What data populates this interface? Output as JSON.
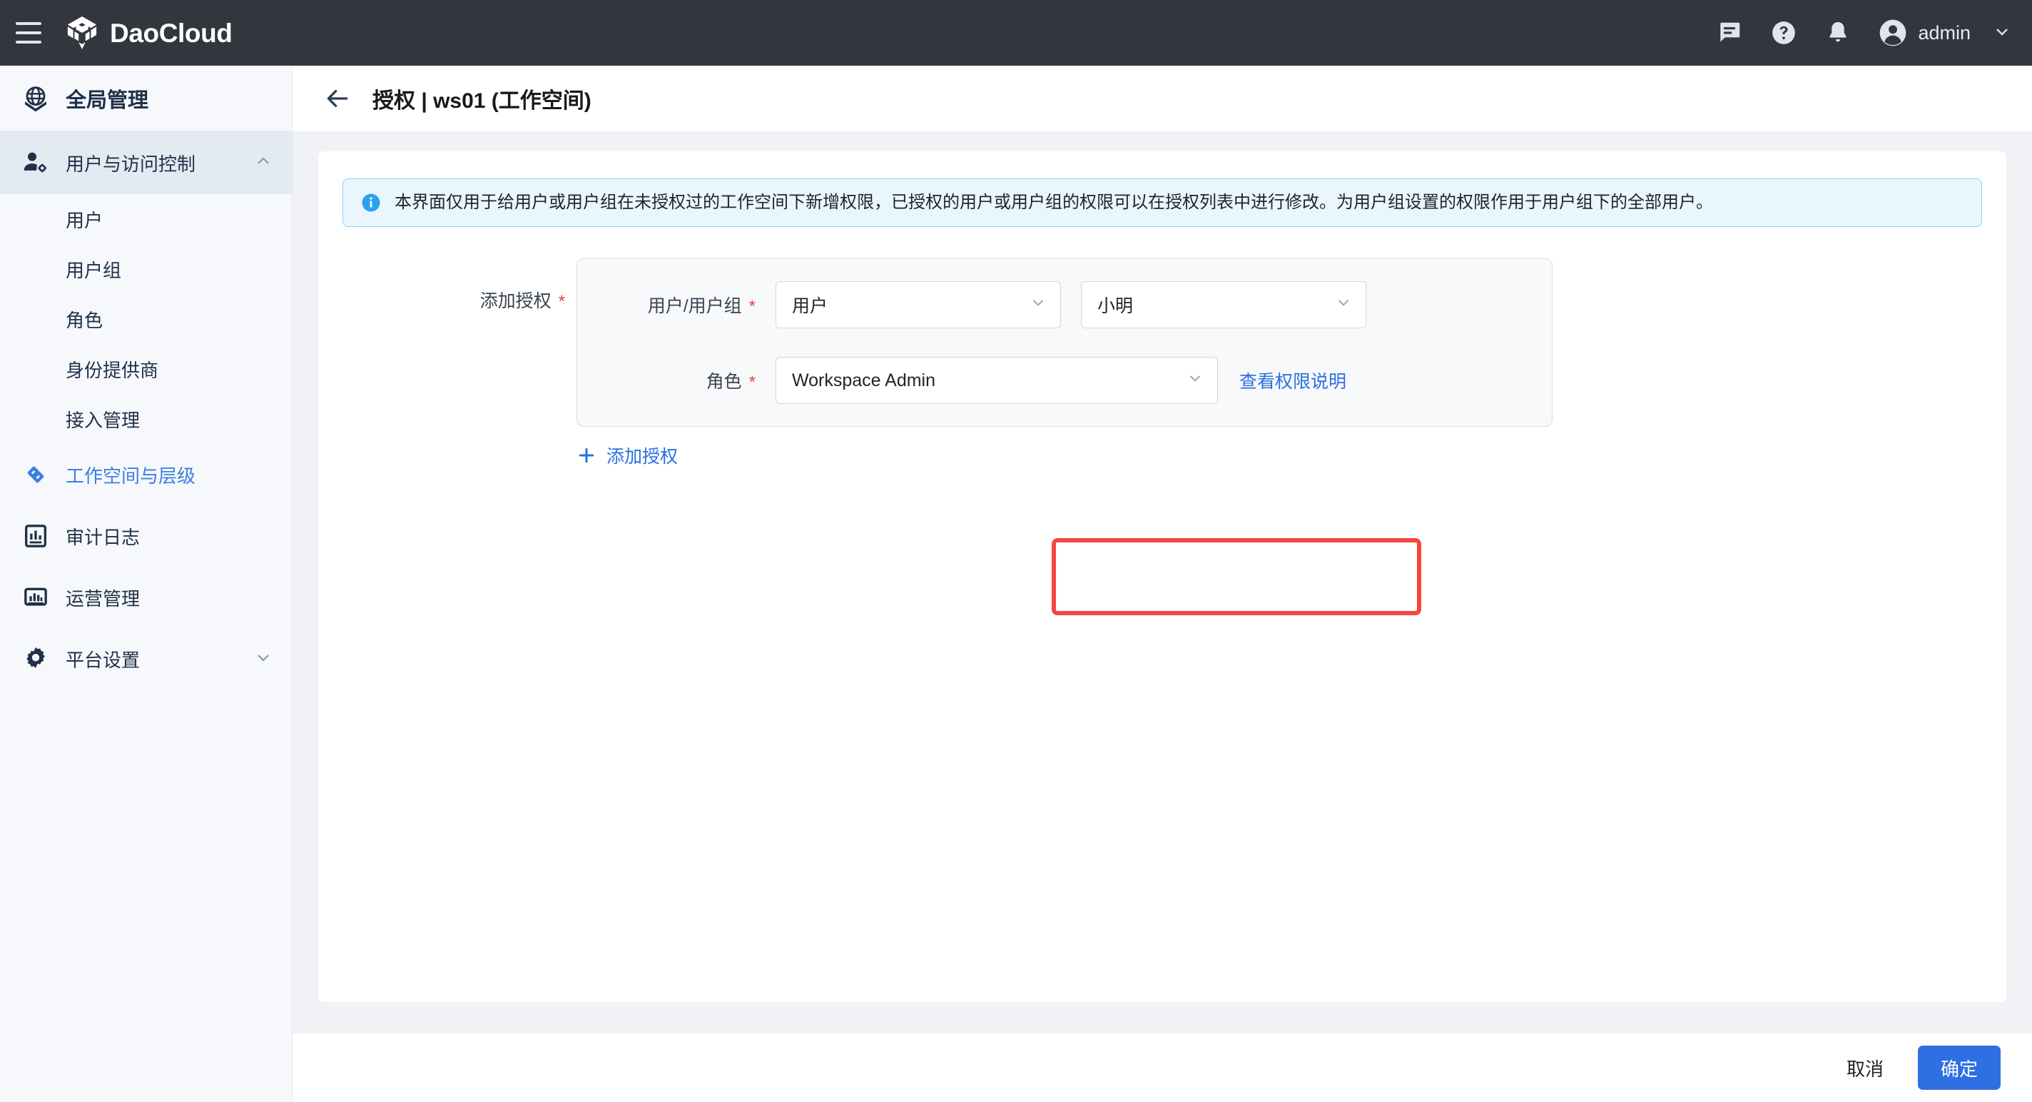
{
  "topbar": {
    "brand": "DaoCloud",
    "menu_icon": "hamburger-icon",
    "icons": [
      "message-icon",
      "help-icon",
      "bell-icon"
    ],
    "user": "admin"
  },
  "sidebar": {
    "top_item": {
      "label": "全局管理",
      "icon": "globe-icon"
    },
    "groups": [
      {
        "label": "用户与访问控制",
        "icon": "user-settings-icon",
        "expanded": true,
        "caret": "chevron-up-icon"
      }
    ],
    "sub_items": [
      {
        "label": "用户"
      },
      {
        "label": "用户组"
      },
      {
        "label": "角色"
      },
      {
        "label": "身份提供商"
      },
      {
        "label": "接入管理"
      }
    ],
    "items": [
      {
        "label": "工作空间与层级",
        "icon": "workspace-icon",
        "active": true
      },
      {
        "label": "审计日志",
        "icon": "audit-icon",
        "active": false
      },
      {
        "label": "运营管理",
        "icon": "operations-icon",
        "active": false
      },
      {
        "label": "平台设置",
        "icon": "gear-icon",
        "active": false,
        "caret": "chevron-down-icon"
      }
    ]
  },
  "page": {
    "back_icon": "arrow-left-icon",
    "title": "授权 | ws01 (工作空间)"
  },
  "banner": {
    "icon": "info-icon",
    "text": "本界面仅用于给用户或用户组在未授权过的工作空间下新增权限，已授权的用户或用户组的权限可以在授权列表中进行修改。为用户组设置的权限作用于用户组下的全部用户。"
  },
  "form": {
    "label": "添加授权",
    "required_mark": "*",
    "fields": {
      "subject_type": {
        "label": "用户/用户组",
        "required_mark": "*",
        "value": "用户",
        "caret": "chevron-down-icon"
      },
      "subject_name": {
        "label": "",
        "value": "小明",
        "caret": "chevron-down-icon"
      },
      "role": {
        "label": "角色",
        "required_mark": "*",
        "value": "Workspace Admin",
        "caret": "chevron-down-icon",
        "help_link": "查看权限说明",
        "highlighted": true,
        "highlight_color": "#f4483f"
      }
    },
    "add_link": "添加授权",
    "add_icon": "plus-icon"
  },
  "footer": {
    "cancel": "取消",
    "confirm": "确定",
    "primary_color": "#2f6fe4"
  }
}
